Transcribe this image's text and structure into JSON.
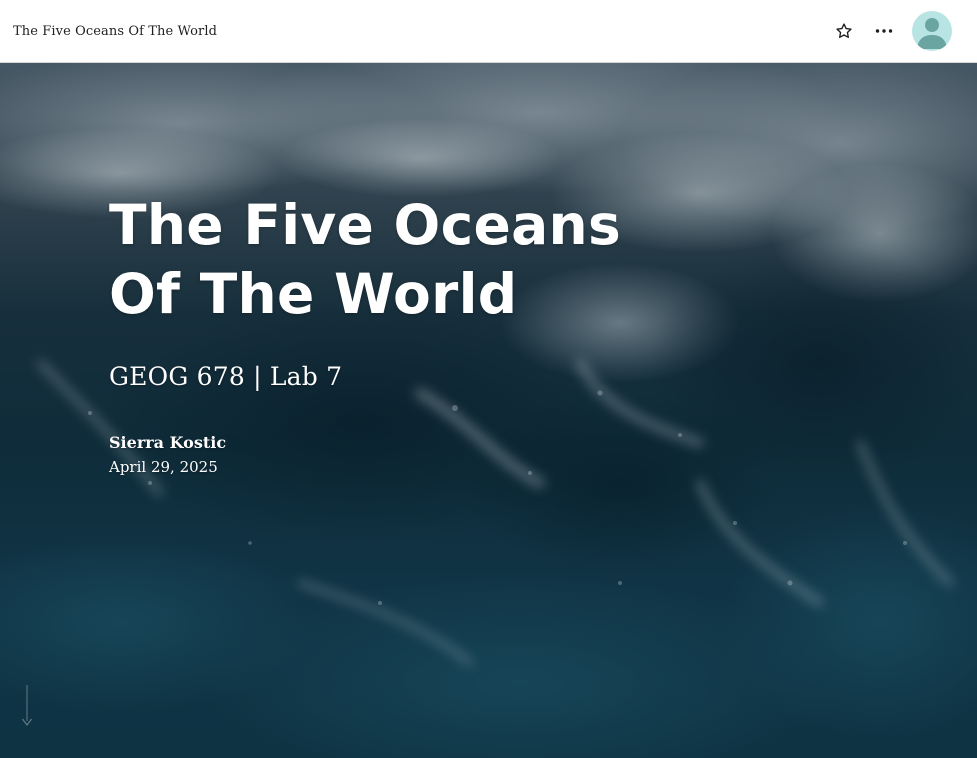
{
  "header": {
    "document_title": "The Five Oceans Of The World",
    "icons": {
      "favorite": "star-outline-icon",
      "more": "more-horizontal-icon",
      "avatar": "user-avatar-icon"
    },
    "colors": {
      "avatar_background": "#b8e4e4",
      "avatar_figure": "#6aa5a2"
    }
  },
  "hero": {
    "title_line_1": "The Five Oceans",
    "title_line_2": "Of The World",
    "subtitle": "GEOG 678 | Lab 7",
    "author": "Sierra Kostic",
    "date": "April 29, 2025",
    "background": "ocean waves aerial photograph",
    "scroll_icon": "arrow-down-icon"
  }
}
